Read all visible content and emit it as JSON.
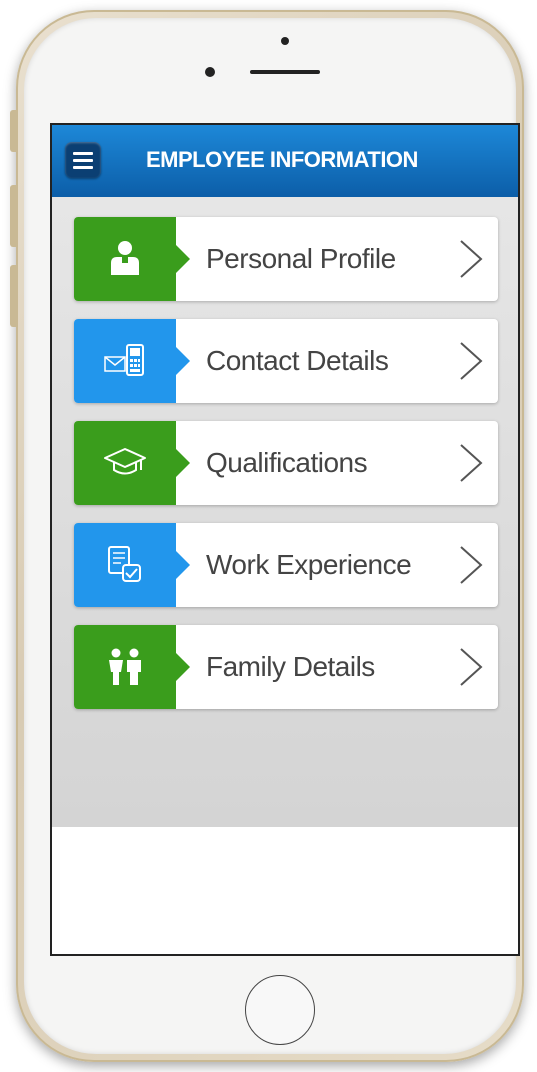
{
  "header": {
    "title": "EMPLOYEE INFORMATION"
  },
  "menu": {
    "items": [
      {
        "label": "Personal Profile",
        "icon": "person-icon",
        "color": "#3a9d1c"
      },
      {
        "label": "Contact Details",
        "icon": "contact-phone-icon",
        "color": "#2296ec"
      },
      {
        "label": "Qualifications",
        "icon": "graduation-cap-icon",
        "color": "#3a9d1c"
      },
      {
        "label": "Work Experience",
        "icon": "document-check-icon",
        "color": "#2296ec"
      },
      {
        "label": "Family Details",
        "icon": "family-icon",
        "color": "#3a9d1c"
      }
    ]
  },
  "colors": {
    "header_blue": "#0c5ea8",
    "accent_green": "#3a9d1c",
    "accent_blue": "#2296ec"
  }
}
